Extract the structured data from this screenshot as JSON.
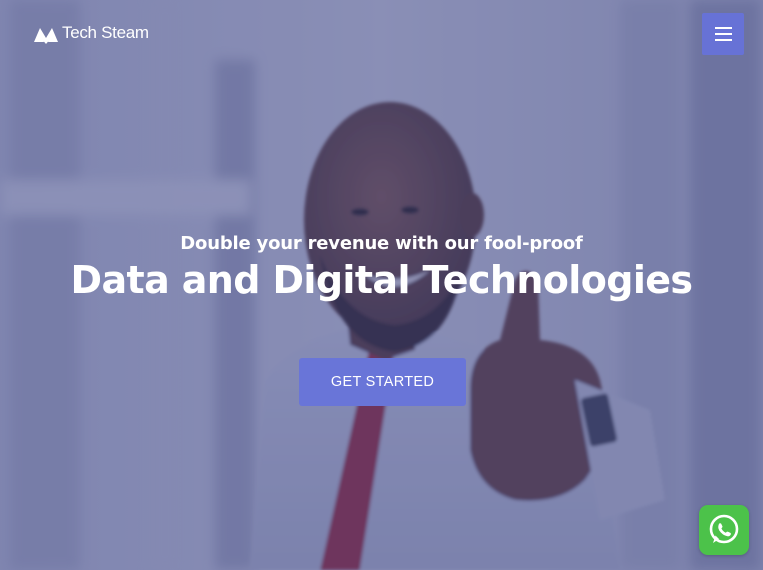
{
  "header": {
    "logo_text": "Tech Steam",
    "menu_icon": "hamburger-menu-icon"
  },
  "hero": {
    "tagline": "Double your revenue with our fool-proof",
    "headline": "Data and Digital Technologies",
    "cta_label": "GET STARTED",
    "background": "person-thumbs-up-photo"
  },
  "floating": {
    "whatsapp_icon": "whatsapp-icon"
  },
  "colors": {
    "accent": "#6772d6",
    "overlay": "#3e4687",
    "whatsapp": "#4cc24a",
    "text": "#ffffff"
  }
}
